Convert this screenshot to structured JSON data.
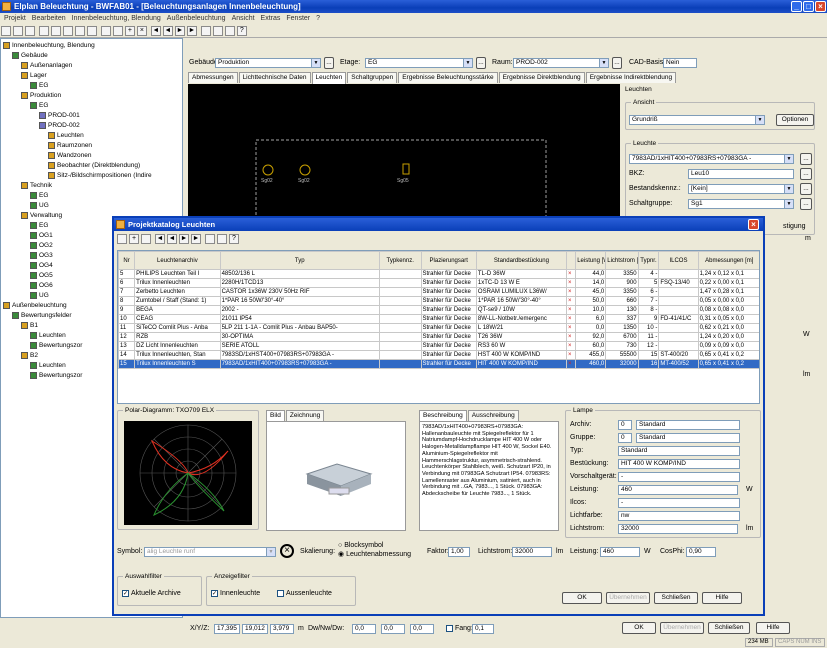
{
  "app": {
    "title": "Elplan Beleuchtung - BWFAB01 - [Beleuchtungsanlagen Innenbeleuchtung]",
    "menu": [
      "Projekt",
      "Bearbeiten",
      "Innenbeleuchtung, Blendung",
      "Außenbeleuchtung",
      "Ansicht",
      "Extras",
      "Fenster",
      "?"
    ]
  },
  "tree": {
    "items": [
      {
        "text": "Innenbeleuchtung, Blendung",
        "level": 0
      },
      {
        "text": "Gebäude",
        "level": 1
      },
      {
        "text": "Außenanlagen",
        "level": 2
      },
      {
        "text": "Lager",
        "level": 2
      },
      {
        "text": "EG",
        "level": 3
      },
      {
        "text": "Produktion",
        "level": 2
      },
      {
        "text": "EG",
        "level": 3
      },
      {
        "text": "PROD-001",
        "level": 4
      },
      {
        "text": "PROD-002",
        "level": 4
      },
      {
        "text": "Leuchten",
        "level": 5
      },
      {
        "text": "Raumzonen",
        "level": 5
      },
      {
        "text": "Wandzonen",
        "level": 5
      },
      {
        "text": "Beobachter (Direktblendung)",
        "level": 5
      },
      {
        "text": "Sitz-/Bildschirmpositionen (Indire",
        "level": 5
      },
      {
        "text": "Technik",
        "level": 2
      },
      {
        "text": "EG",
        "level": 3
      },
      {
        "text": "UG",
        "level": 3
      },
      {
        "text": "Verwaltung",
        "level": 2
      },
      {
        "text": "EG",
        "level": 3
      },
      {
        "text": "OG1",
        "level": 3
      },
      {
        "text": "OG2",
        "level": 3
      },
      {
        "text": "OG3",
        "level": 3
      },
      {
        "text": "OG4",
        "level": 3
      },
      {
        "text": "OG5",
        "level": 3
      },
      {
        "text": "OG6",
        "level": 3
      },
      {
        "text": "UG",
        "level": 3
      },
      {
        "text": "Außenbeleuchtung",
        "level": 0
      },
      {
        "text": "Bewertungsfelder",
        "level": 1
      },
      {
        "text": "B1",
        "level": 2
      },
      {
        "text": "Leuchten",
        "level": 3
      },
      {
        "text": "Bewertungszor",
        "level": 3
      },
      {
        "text": "B2",
        "level": 2
      },
      {
        "text": "Leuchten",
        "level": 3
      },
      {
        "text": "Bewertungszor",
        "level": 3
      }
    ]
  },
  "header": {
    "gebaeude_label": "Gebäude:",
    "gebaeude_value": "Produktion",
    "etage_label": "Etage:",
    "etage_value": "EG",
    "raum_label": "Raum:",
    "raum_value": "PROD-002",
    "cad_label": "CAD-Basis:",
    "cad_value": "Nein"
  },
  "tabs": [
    "Abmessungen",
    "Lichttechnische Daten",
    "Leuchten",
    "Schaltgruppen",
    "Ergebnisse Beleuchtungsstärke",
    "Ergebnisse Direktblendung",
    "Ergebnisse Indirektblendung"
  ],
  "cad_labels": [
    "Sg02",
    "Sg02",
    "Sg05"
  ],
  "right": {
    "leuchten": "Leuchten",
    "ansicht": "Ansicht",
    "ansicht_value": "Grundriß",
    "optionen": "Optionen",
    "leuchte": "Leuchte",
    "leuchte_value": "7983AD/1xHIT400+07983RS+07983GA -",
    "bkz_label": "BKZ:",
    "bkz_value": "Leu10",
    "bestand_label": "Bestandskennz.:",
    "bestand_value": "[Kein]",
    "schalt_label": "Schaltgruppe:",
    "schalt_value": "Sg1",
    "bestaetigung": "stigung",
    "m": "m",
    "w": "W",
    "lm": "lm"
  },
  "dialog": {
    "title": "Projektkatalog Leuchten",
    "columns": [
      "Nr",
      "Leuchtenarchiv",
      "Typ",
      "Typkennz.",
      "Plazierungsart",
      "Standardbestückung",
      "",
      "Leistung [W]",
      "Lichtstrom [lm]",
      "Typnr.",
      "ILCOS",
      "Abmessungen [m]"
    ],
    "rows": [
      [
        "5",
        "PHILIPS Leuchten Teil I",
        "48502/136 L",
        "",
        "Strahler für Decke",
        "TL-D 36W",
        "",
        "44,0",
        "3350",
        "4 -",
        "",
        "1,24 x 0,12 x 0,1"
      ],
      [
        "6",
        "Trilux Innenleuchten",
        "2280H/1TCD13",
        "",
        "Strahler für Decke",
        "1xTC-D 13 W E",
        "",
        "14,0",
        "900",
        "5",
        "FSQ-13/40",
        "0,22 x 0,00 x 0,1"
      ],
      [
        "7",
        "Zerbetto Leuchten",
        "CASTOR 1x36W 230V 50Hz RIF",
        "",
        "Strahler für Decke",
        "OSRAM LUMILUX L36W/",
        "",
        "45,0",
        "3350",
        "6 -",
        "",
        "1,47 x 0,28 x 0,1"
      ],
      [
        "8",
        "Zumtobel / Staff (Stand: 1)",
        "1*PAR 16 50W/'30°-40°",
        "",
        "Strahler für Decke",
        "1*PAR 16 50W/'30°-40°",
        "",
        "50,0",
        "660",
        "7 -",
        "",
        "0,05 x 0,00 x 0,0"
      ],
      [
        "9",
        "BEGA",
        "2002 -",
        "",
        "Strahler für Decke",
        "QT-se9 / 10W",
        "",
        "10,0",
        "130",
        "8 -",
        "",
        "0,08 x 0,08 x 0,0"
      ],
      [
        "10",
        "CEAG",
        "21011 IP54",
        "",
        "Strahler für Decke",
        "8W-LL-Notbetr./emergenc",
        "",
        "6,0",
        "337",
        "9",
        "FD-41/41/C",
        "0,31 x 0,05 x 0,0"
      ],
      [
        "11",
        "SiTeCO Comlit Plus - Anba",
        "5LP 211 1-1A - Comlit Plus - Anbau BAP50-",
        "",
        "Strahler für Decke",
        "L 18W/21",
        "",
        "0,0",
        "1350",
        "10 -",
        "",
        "0,62 x 0,21 x 0,0"
      ],
      [
        "12",
        "RZB",
        "30-OPTIMA",
        "",
        "Strahler für Decke",
        "T26 36W",
        "",
        "92,0",
        "6700",
        "11 -",
        "",
        "1,24 x 0,20 x 0,0"
      ],
      [
        "13",
        "DZ Licht Innenleuchten",
        "SERIE ATOLL",
        "",
        "Strahler für Decke",
        "RS3 60 W",
        "",
        "60,0",
        "730",
        "12 -",
        "",
        "0,09 x 0,09 x 0,0"
      ],
      [
        "14",
        "Trilux Innenleuchten, Stan",
        "7983SD/1xHST400+07983RS+07983GA -",
        "",
        "Strahler für Decke",
        "HST 400 W KOMP/IND",
        "",
        "455,0",
        "55500",
        "15",
        "ST-400/20",
        "0,65 x 0,41 x 0,2"
      ],
      [
        "15",
        "Trilux Innenleuchten S",
        "7983AD/1xHIT400+07983RS+07983GA -",
        "",
        "Strahler für Decke",
        "HIT 400 W KOMP/IND",
        "",
        "460,0",
        "32000",
        "16",
        "MT-400/52",
        "0,65 x 0,41 x 0,2"
      ]
    ],
    "polar_title": "Polar-Diagramm: TXO709 ELX",
    "bild_tabs": [
      "Bild",
      "Zeichnung"
    ],
    "beschr_tabs": [
      "Beschreibung",
      "Ausschreibung"
    ],
    "beschreibung": "7983AD/1xHIT400+07983RS+07983GA: Hallenanbauleuchte mit Spiegelreflektor für 1 Natriumdampf-Hochdrucklampe HIT 400 W oder Halogen-Metalldampflampe HIT 400 W, Sockel E40. Aluminium-Spiegelreflektor mit Hammerschlagstruktur, asymmetrisch-strahlend. Leuchtenkörper Stahlblech, weiß. Schutzart IP20, in Verbindung mit 07983GA Schutzart IP54. 07983RS: Lamellenraster aus Aluminium, satiniert, auch in Verbindung mit ..GA, 7983..., 1 Stück. 07983GA: Abdeckscheibe für Leuchte 7983..., 1 Stück.",
    "lampe": {
      "title": "Lampe",
      "archiv_label": "Archiv:",
      "archiv_nr": "0",
      "archiv_value": "Standard",
      "gruppe_label": "Gruppe:",
      "gruppe_nr": "0",
      "gruppe_value": "Standard",
      "typ_label": "Typ:",
      "typ_value": "Standard",
      "best_label": "Bestückung:",
      "best_value": "HIT 400 W KOMP/IND",
      "vorsch_label": "Vorschaltgerät:",
      "vorsch_value": "-",
      "leistung_label": "Leistung:",
      "leistung_value": "460",
      "leistung_unit": "W",
      "ilcos_label": "Ilcos:",
      "ilcos_value": "-",
      "lichtfarbe_label": "Lichtfarbe:",
      "lichtfarbe_value": "nw",
      "lichtstrom_label": "Lichtstrom:",
      "lichtstrom_value": "32000",
      "lichtstrom_unit": "lm"
    },
    "symbol_label": "Symbol:",
    "symbol_value": "alig Leuchte runf",
    "skalierung_label": "Skalierung:",
    "radio1": "Blocksymbol",
    "radio2": "Leuchtenabmessung",
    "faktor_label": "Faktor:",
    "faktor_value": "1,00",
    "lichtstrom_label": "Lichtstrom:",
    "lichtstrom_value": "32000",
    "lm": "lm",
    "leistung_label": "Leistung:",
    "leistung_value": "460",
    "w": "W",
    "cosphi_label": "CosPhi:",
    "cosphi_value": "0,90",
    "auswahl_title": "Auswahlfilter",
    "aktuelle": "Aktuelle Archive",
    "anzeige_title": "Anzeigefilter",
    "innen": "Innenleuchte",
    "aussen": "Aussenleuchte",
    "ok": "OK",
    "uebernehmen": "Übernehmen",
    "schliessen": "Schließen",
    "hilfe": "Hilfe"
  },
  "bottom": {
    "xyz_label": "X/Y/Z:",
    "x": "17,395",
    "y": "19,012",
    "z": "3,979",
    "m": "m",
    "dw_label": "Dw/Nw/Dw:",
    "d1": "0,0",
    "d2": "0,0",
    "d3": "0,0",
    "fang": "Fang:",
    "fang_value": "0,1",
    "ok": "OK",
    "uebernehmen": "Übernehmen",
    "schliessen": "Schließen",
    "hilfe": "Hilfe",
    "status": "234 MB",
    "status2": "CAPS NUM INS"
  }
}
